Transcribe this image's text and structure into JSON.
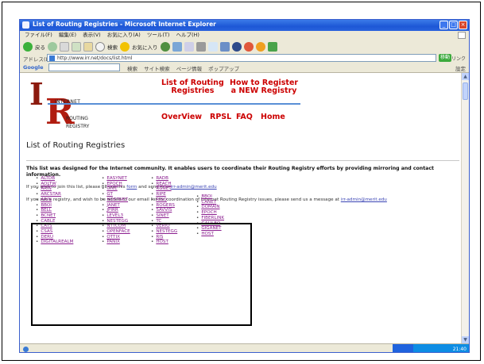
{
  "window": {
    "title": "List of Routing Registries - Microsoft Internet Explorer",
    "buttons": [
      "_",
      "□",
      "×"
    ]
  },
  "menubar": [
    "ファイル(F)",
    "編集(E)",
    "表示(V)",
    "お気に入り(A)",
    "ツール(T)",
    "ヘルプ(H)"
  ],
  "toolbar": {
    "back_label": "戻る",
    "search_label": "検索",
    "favorites_label": "お気に入り"
  },
  "address": {
    "label": "アドレス(D)",
    "url": "http://www.irr.net/docs/list.html",
    "go_label": "移動",
    "links_label": "リンク"
  },
  "googlebar": {
    "logo": "Google",
    "items": [
      "検索",
      "サイト検索",
      "ページ情報",
      "ポップアップ"
    ],
    "settings": "設定"
  },
  "site": {
    "logo": {
      "i": "I",
      "r": "R",
      "w1": "INTERNET",
      "w2": "ROUTING",
      "w3": "REGISTRY"
    },
    "nav": {
      "list": "List of Routing\nRegistries",
      "register": "How to Register\na NEW Registry",
      "overview": "OverView",
      "rpsl": "RPSL",
      "faq": "FAQ",
      "home": "Home"
    }
  },
  "page": {
    "heading": "List of Routing Registries",
    "intro": "This list was designed for the Internet community. It enables users to coordinate their Routing Registry efforts by providing mirroring and contact information.",
    "para1": {
      "before": "If you wish to join this list, please fill out this ",
      "link": "form",
      "after": " and send it to ",
      "email": "irr-admin@merit.edu"
    },
    "para2": {
      "before": "If you run a registry, and wish to be added to our email list for coordination of Internet Routing Registry issues, please send us a message at ",
      "email": "irr-admin@merit.edu"
    }
  },
  "registries": {
    "col1": [
      "ALTDB",
      "AOLTW",
      "ARIN",
      "ARCSTAR",
      "ARIN",
      "BBOI",
      "BELL",
      "BCNET",
      "CABLE",
      "CATS",
      "CSAS",
      "DERU",
      "DIGITALREALM"
    ],
    "col2": [
      "EASYNET",
      "EPOCH",
      "GIVE",
      "GT",
      "HOSTNET",
      "JANET",
      "JPIRR",
      "LEVEL3",
      "NESTEGG",
      "NTTCOM",
      "OPENFACE",
      "OTTIX",
      "PANIX"
    ],
    "col3": [
      "RADB",
      "REACH",
      "RGNET",
      "RIPE",
      "RISQ",
      "ROGERS",
      "SAVVIS",
      "SINET",
      "TC",
      "VERIO",
      "NESTEGG",
      "RIS",
      "HOST"
    ],
    "col4": [
      "BBOI",
      "CANET",
      "DOMAIN",
      "EPOCH",
      "FIBERLINK",
      "GALILEO",
      "GIGANET",
      "HOST"
    ]
  },
  "statusbar": {
    "clock": "21:40"
  }
}
